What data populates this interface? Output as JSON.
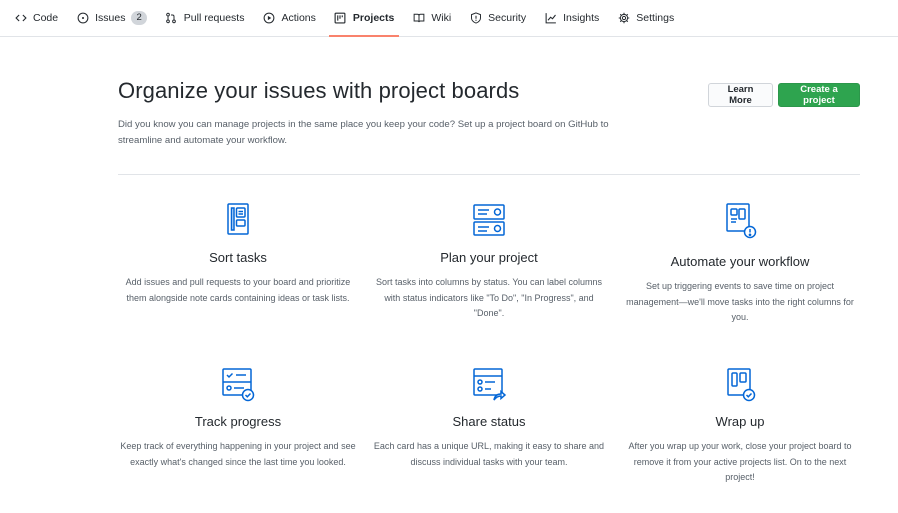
{
  "nav": {
    "items": [
      {
        "label": "Code",
        "icon": "code-icon"
      },
      {
        "label": "Issues",
        "icon": "issue-opened-icon",
        "count": "2"
      },
      {
        "label": "Pull requests",
        "icon": "git-pull-request-icon"
      },
      {
        "label": "Actions",
        "icon": "play-icon"
      },
      {
        "label": "Projects",
        "icon": "project-icon",
        "selected": true
      },
      {
        "label": "Wiki",
        "icon": "book-icon"
      },
      {
        "label": "Security",
        "icon": "shield-icon"
      },
      {
        "label": "Insights",
        "icon": "graph-icon"
      },
      {
        "label": "Settings",
        "icon": "gear-icon"
      }
    ]
  },
  "blankslate": {
    "title": "Organize your issues with project boards",
    "description": "Did you know you can manage projects in the same place you keep your code? Set up a project board on GitHub to streamline and automate your workflow.",
    "learn_more": "Learn More",
    "create_project": "Create a project"
  },
  "features": [
    {
      "title": "Sort tasks",
      "icon": "sort-tasks-icon",
      "text": "Add issues and pull requests to your board and prioritize them alongside note cards containing ideas or task lists."
    },
    {
      "title": "Plan your project",
      "icon": "plan-project-icon",
      "text": "Sort tasks into columns by status. You can label columns with status indicators like \"To Do\", \"In Progress\", and \"Done\"."
    },
    {
      "title": "Automate your workflow",
      "icon": "automate-workflow-icon",
      "text": "Set up triggering events to save time on project management—we'll move tasks into the right columns for you."
    },
    {
      "title": "Track progress",
      "icon": "track-progress-icon",
      "text": "Keep track of everything happening in your project and see exactly what's changed since the last time you looked."
    },
    {
      "title": "Share status",
      "icon": "share-status-icon",
      "text": "Each card has a unique URL, making it easy to share and discuss individual tasks with your team."
    },
    {
      "title": "Wrap up",
      "icon": "wrap-up-icon",
      "text": "After you wrap up your work, close your project board to remove it from your active projects list. On to the next project!"
    }
  ],
  "colors": {
    "accent_blue": "#0366d6",
    "create_green": "#2ea44f",
    "selected_underline": "#f9826c",
    "muted_text": "#586069"
  }
}
